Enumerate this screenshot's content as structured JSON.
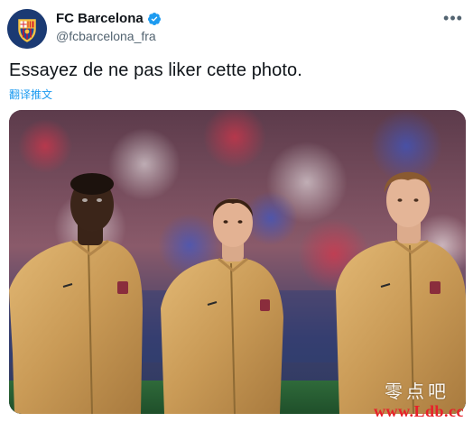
{
  "account": {
    "name": "FC Barcelona",
    "handle": "@fcbarcelona_fra",
    "avatar_icon": "fc-barcelona-crest-icon",
    "verified_icon": "verified-badge-icon",
    "verified_color": "#1d9bf0"
  },
  "menu": {
    "more_label": "•••"
  },
  "tweet": {
    "text": "Essayez de ne pas liker cette photo.",
    "translate_label": "翻译推文"
  },
  "photo": {
    "description_icon": "photo-three-players-in-gold-jackets"
  },
  "watermark": {
    "chinese": "零点吧",
    "url": "www.Ldb.cc",
    "url_color": "#e8202a"
  }
}
